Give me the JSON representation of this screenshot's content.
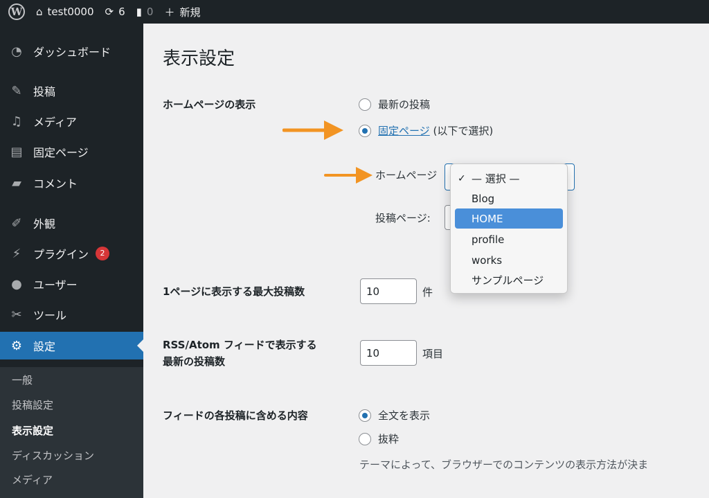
{
  "adminbar": {
    "site_name": "test0000",
    "updates_count": "6",
    "comments_count": "0",
    "new_label": "新規"
  },
  "sidebar": {
    "items": [
      {
        "label": "ダッシュボード",
        "icon": "dashboard-icon"
      },
      {
        "label": "投稿",
        "icon": "pin-icon"
      },
      {
        "label": "メディア",
        "icon": "media-icon"
      },
      {
        "label": "固定ページ",
        "icon": "page-icon"
      },
      {
        "label": "コメント",
        "icon": "comment-icon"
      },
      {
        "label": "外観",
        "icon": "appearance-icon"
      },
      {
        "label": "プラグイン",
        "icon": "plugin-icon",
        "badge": "2"
      },
      {
        "label": "ユーザー",
        "icon": "user-icon"
      },
      {
        "label": "ツール",
        "icon": "wrench-icon"
      },
      {
        "label": "設定",
        "icon": "settings-icon",
        "current": true
      }
    ],
    "submenu": [
      "一般",
      "投稿設定",
      "表示設定",
      "ディスカッション",
      "メディア"
    ],
    "submenu_current": "表示設定"
  },
  "main": {
    "title": "表示設定",
    "homepage_label": "ホームページの表示",
    "radio_latest": "最新の投稿",
    "radio_static_link": "固定ページ",
    "radio_static_suffix": "(以下で選択)",
    "homepage_select_label": "ホームページ",
    "posts_page_label": "投稿ページ:",
    "posts_per_page_label": "1ページに表示する最大投稿数",
    "posts_per_page_value": "10",
    "posts_per_page_unit": "件",
    "rss_label_line1": "RSS/Atom フィードで表示する",
    "rss_label_line2": "最新の投稿数",
    "rss_value": "10",
    "rss_unit": "項目",
    "feed_content_label": "フィードの各投稿に含める内容",
    "feed_full": "全文を表示",
    "feed_excerpt": "抜粋",
    "feed_desc": "テーマによって、ブラウザーでのコンテンツの表示方法が決ま"
  },
  "dropdown": {
    "options": [
      "— 選択 —",
      "Blog",
      "HOME",
      "profile",
      "works",
      "サンプルページ"
    ],
    "checked": "— 選択 —",
    "highlighted": "HOME"
  },
  "colors": {
    "admin_dark": "#1d2327",
    "accent": "#2271b1",
    "arrow": "#f29423"
  }
}
